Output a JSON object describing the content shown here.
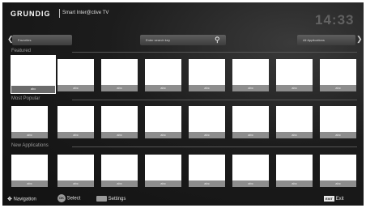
{
  "header": {
    "brand": "GRUNDIG",
    "subtitle": "Smart Inter@ctive TV",
    "clock": "14:33"
  },
  "toolbar": {
    "left_arrow": "❮",
    "right_arrow": "❯",
    "category_label": "Favorites",
    "search_placeholder": "Enter search key",
    "filter_label": "All Applications",
    "search_icon": "⚲"
  },
  "sections": [
    {
      "title": "Featured",
      "cards": [
        "abc",
        "abc",
        "abc",
        "abc",
        "abc",
        "abc",
        "abc",
        "abc"
      ]
    },
    {
      "title": "Most Popular",
      "cards": [
        "abc",
        "abc",
        "abc",
        "abc",
        "abc",
        "abc",
        "abc",
        "abc"
      ]
    },
    {
      "title": "New Applications",
      "cards": [
        "abc",
        "abc",
        "abc",
        "abc",
        "abc",
        "abc",
        "abc",
        "abc"
      ]
    }
  ],
  "footer": {
    "navigation_label": "Navigation",
    "ok_key": "OK",
    "select_label": "Select",
    "settings_label": "Settings",
    "exit_key": "EXIT",
    "exit_label": "Exit"
  }
}
